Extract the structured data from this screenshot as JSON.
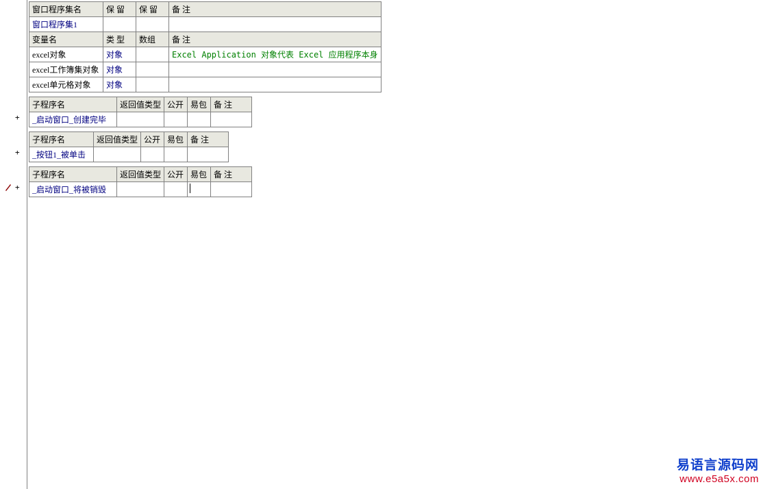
{
  "assembly_table": {
    "headers": {
      "col1": "窗口程序集名",
      "col2": "保 留",
      "col3": "保 留",
      "col4": "备 注"
    },
    "name": "窗口程序集1"
  },
  "var_table": {
    "headers": {
      "col1": "变量名",
      "col2": "类 型",
      "col3": "数组",
      "col4": "备 注"
    },
    "rows": [
      {
        "name": "excel对象",
        "type": "对象",
        "array": "",
        "comment": "Excel Application 对象代表 Excel 应用程序本身"
      },
      {
        "name": "excel工作簿集对象",
        "type": "对象",
        "array": "",
        "comment": ""
      },
      {
        "name": "excel单元格对象",
        "type": "对象",
        "array": "",
        "comment": ""
      }
    ]
  },
  "sub_headers": {
    "col1": "子程序名",
    "col2": "返回值类型",
    "col3": "公开",
    "col4": "易包",
    "col5": "备 注"
  },
  "subs": [
    {
      "name": "_启动窗口_创建完毕"
    },
    {
      "name": "_按钮1_被单击"
    },
    {
      "name": "_启动窗口_将被销毁"
    }
  ],
  "watermark": {
    "line1": "易语言源码网",
    "line2": "www.e5a5x.com"
  }
}
